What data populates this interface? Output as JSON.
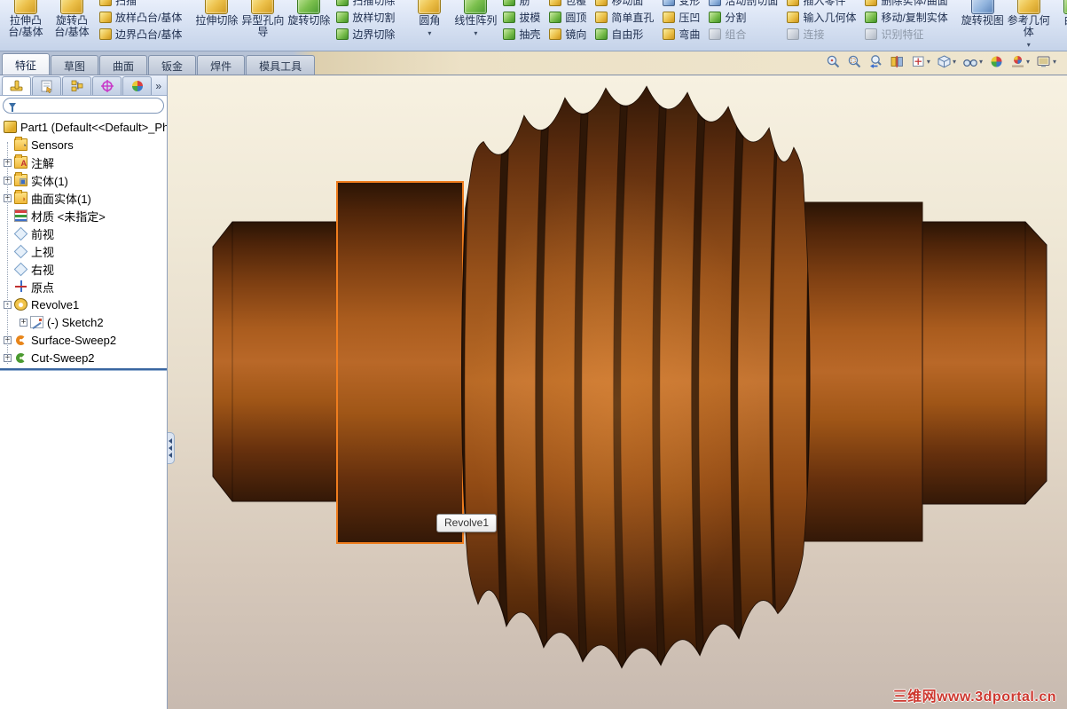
{
  "ribbon": {
    "tabs": [
      {
        "label": "特征",
        "active": true
      },
      {
        "label": "草图",
        "active": false
      },
      {
        "label": "曲面",
        "active": false
      },
      {
        "label": "钣金",
        "active": false
      },
      {
        "label": "焊件",
        "active": false
      },
      {
        "label": "模具工具",
        "active": false
      }
    ]
  },
  "toolbar": {
    "groups": [
      {
        "type": "big",
        "icon": "extruded-boss-icon",
        "label": "拉伸凸台/基体"
      },
      {
        "type": "big",
        "icon": "revolved-boss-icon",
        "label": "旋转凸台/基体"
      },
      {
        "type": "stack",
        "items": [
          {
            "icon": "swept-boss-icon",
            "label": "扫描"
          },
          {
            "icon": "lofted-boss-icon",
            "label": "放样凸台/基体"
          },
          {
            "icon": "boundary-boss-icon",
            "label": "边界凸台/基体"
          }
        ]
      },
      {
        "type": "sep"
      },
      {
        "type": "big",
        "icon": "extruded-cut-icon",
        "label": "拉伸切除"
      },
      {
        "type": "big",
        "icon": "hole-wizard-icon",
        "label": "异型孔向导"
      },
      {
        "type": "big",
        "icon": "revolved-cut-icon",
        "label": "旋转切除"
      },
      {
        "type": "stack",
        "items": [
          {
            "icon": "swept-cut-icon",
            "label": "扫描切除"
          },
          {
            "icon": "lofted-cut-icon",
            "label": "放样切割"
          },
          {
            "icon": "boundary-cut-icon",
            "label": "边界切除"
          }
        ]
      },
      {
        "type": "sep"
      },
      {
        "type": "big",
        "icon": "fillet-icon",
        "label": "圆角",
        "dropdown": "▾"
      },
      {
        "type": "big",
        "icon": "linear-pattern-icon",
        "label": "线性阵列",
        "dropdown": "▾"
      },
      {
        "type": "stack",
        "items": [
          {
            "icon": "rib-icon",
            "label": "筋"
          },
          {
            "icon": "draft-icon",
            "label": "拔模"
          },
          {
            "icon": "shell-icon",
            "label": "抽壳"
          }
        ]
      },
      {
        "type": "stack",
        "items": [
          {
            "icon": "wrap-icon",
            "label": "包覆"
          },
          {
            "icon": "dome-icon",
            "label": "圆顶"
          },
          {
            "icon": "mirror-icon",
            "label": "镜向"
          }
        ]
      },
      {
        "type": "stack",
        "items": [
          {
            "icon": "move-face-icon",
            "label": "移动面"
          },
          {
            "icon": "simple-hole-icon",
            "label": "简单直孔"
          },
          {
            "icon": "freeform-icon",
            "label": "自由形"
          }
        ]
      },
      {
        "type": "stack",
        "items": [
          {
            "icon": "deform-icon",
            "label": "变形"
          },
          {
            "icon": "indent-icon",
            "label": "压凹"
          },
          {
            "icon": "flex-icon",
            "label": "弯曲"
          }
        ]
      },
      {
        "type": "stack",
        "items": [
          {
            "icon": "live-section-icon",
            "label": "活动剖切面"
          },
          {
            "icon": "split-icon",
            "label": "分割"
          },
          {
            "icon": "combine-icon",
            "label": "组合",
            "disabled": true
          }
        ]
      },
      {
        "type": "stack",
        "items": [
          {
            "icon": "insert-part-icon",
            "label": "插入零件"
          },
          {
            "icon": "imported-geometry-icon",
            "label": "输入几何体"
          },
          {
            "icon": "join-icon",
            "label": "连接",
            "disabled": true
          }
        ]
      },
      {
        "type": "stack",
        "items": [
          {
            "icon": "delete-body-icon",
            "label": "删除实体/曲面"
          },
          {
            "icon": "move-copy-body-icon",
            "label": "移动/复制实体"
          },
          {
            "icon": "recognize-features-icon",
            "label": "识别特征",
            "disabled": true
          }
        ]
      },
      {
        "type": "sep"
      },
      {
        "type": "big",
        "icon": "rotate-view-icon",
        "label": "旋转视图"
      },
      {
        "type": "big",
        "icon": "reference-geometry-icon",
        "label": "参考几何体",
        "dropdown": "▾"
      },
      {
        "type": "big",
        "icon": "curves-icon",
        "label": "曲线",
        "dropdown": "▾"
      }
    ]
  },
  "headsup": {
    "icons": [
      {
        "name": "zoom-fit-icon"
      },
      {
        "name": "zoom-area-icon"
      },
      {
        "name": "zoom-previous-icon"
      },
      {
        "name": "section-view-icon"
      },
      {
        "name": "view-orientation-icon",
        "dropdown": "▾"
      },
      {
        "name": "display-style-icon",
        "dropdown": "▾"
      },
      {
        "name": "hide-show-items-icon",
        "dropdown": "▾"
      },
      {
        "name": "edit-appearance-icon"
      },
      {
        "name": "apply-scene-icon",
        "dropdown": "▾"
      },
      {
        "name": "view-settings-icon",
        "dropdown": "▾"
      }
    ]
  },
  "panel": {
    "tabs": [
      "featuremanager",
      "propertymanager",
      "configurationmanager",
      "dimxpertmanager",
      "displaymanager"
    ],
    "overflow_chevron": "»",
    "filter": {
      "value": ""
    }
  },
  "tree": {
    "items": [
      {
        "label": "Part1 (Default<<Default>_Ph",
        "icon": "part-icon",
        "expand": ""
      },
      {
        "label": "Sensors",
        "icon": "sensors-folder-icon",
        "expand": ""
      },
      {
        "label": "注解",
        "icon": "annotations-folder-icon",
        "expand": "+"
      },
      {
        "label": "实体(1)",
        "icon": "solid-bodies-folder-icon",
        "expand": "+"
      },
      {
        "label": "曲面实体(1)",
        "icon": "surface-bodies-folder-icon",
        "expand": "+"
      },
      {
        "label": "材质 <未指定>",
        "icon": "material-icon",
        "expand": ""
      },
      {
        "label": "前视",
        "icon": "front-plane-icon",
        "expand": ""
      },
      {
        "label": "上视",
        "icon": "top-plane-icon",
        "expand": ""
      },
      {
        "label": "右视",
        "icon": "right-plane-icon",
        "expand": ""
      },
      {
        "label": "原点",
        "icon": "origin-icon",
        "expand": ""
      },
      {
        "label": "Revolve1",
        "icon": "revolve-feature-icon",
        "expand": "-"
      },
      {
        "label": "(-) Sketch2",
        "icon": "sketch-icon",
        "expand": "+"
      },
      {
        "label": "Surface-Sweep2",
        "icon": "surface-sweep-icon",
        "expand": "+"
      },
      {
        "label": "Cut-Sweep2",
        "icon": "cut-sweep-icon",
        "expand": "+"
      }
    ]
  },
  "viewport": {
    "tooltip": "Revolve1",
    "watermark": "三维网www.3dportal.cn"
  },
  "colors": {
    "selection_orange": "#ef7d1e",
    "model_brown_mid": "#b96a26",
    "model_brown_dark": "#2e1707",
    "rollback_blue": "#3a66a0"
  }
}
